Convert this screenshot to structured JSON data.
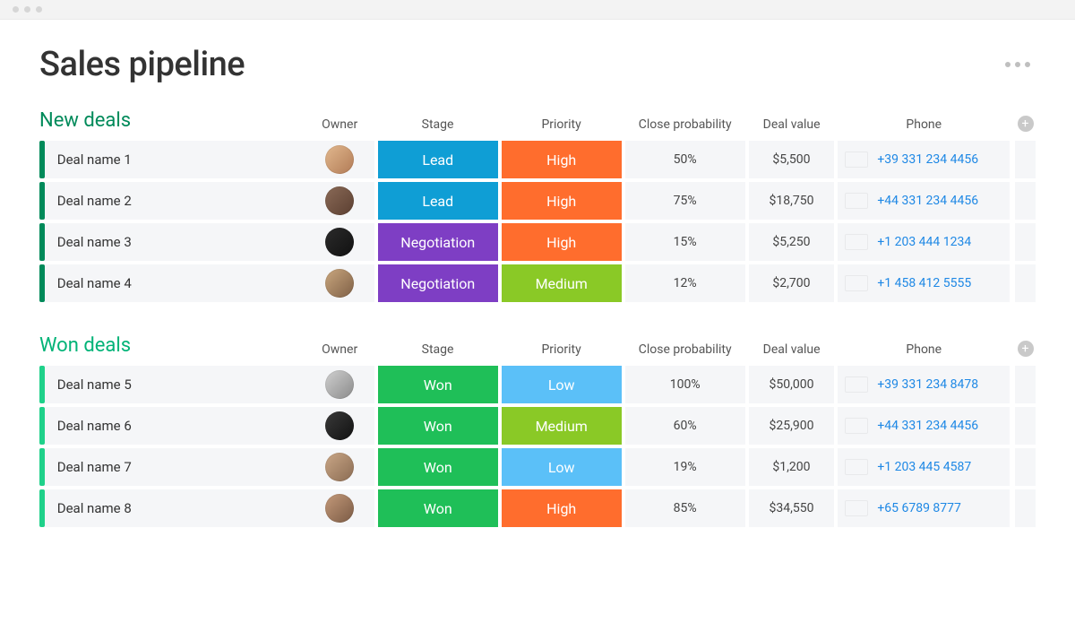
{
  "page": {
    "title": "Sales pipeline"
  },
  "columns": {
    "owner": "Owner",
    "stage": "Stage",
    "priority": "Priority",
    "close_probability": "Close probability",
    "deal_value": "Deal value",
    "phone": "Phone"
  },
  "colors": {
    "stage": {
      "Lead": "bg-blue",
      "Negotiation": "bg-purple",
      "Won": "bg-green"
    },
    "priority": {
      "High": "bg-orange",
      "Medium": "bg-lime",
      "Low": "bg-sky"
    }
  },
  "sections": [
    {
      "title": "New deals",
      "accent": "#008a5a",
      "title_class": "dark",
      "rows": [
        {
          "name": "Deal name 1",
          "avatar": "linear-gradient(135deg,#e2b98f,#b17a55)",
          "stage": "Lead",
          "priority": "High",
          "prob": "50%",
          "value": "$5,500",
          "flag": "tonga",
          "phone": "+39 331 234 4456"
        },
        {
          "name": "Deal name 2",
          "avatar": "linear-gradient(135deg,#8a6a57,#5b3f31)",
          "stage": "Lead",
          "priority": "High",
          "prob": "75%",
          "value": "$18,750",
          "flag": "uk",
          "phone": "+44 331 234 4456"
        },
        {
          "name": "Deal name 3",
          "avatar": "linear-gradient(135deg,#2b2b2b,#111111)",
          "stage": "Negotiation",
          "priority": "High",
          "prob": "15%",
          "value": "$5,250",
          "flag": "us",
          "phone": "+1 203 444 1234"
        },
        {
          "name": "Deal name 4",
          "avatar": "linear-gradient(135deg,#caa77f,#7e5f45)",
          "stage": "Negotiation",
          "priority": "Medium",
          "prob": "12%",
          "value": "$2,700",
          "flag": "us",
          "phone": "+1 458 412 5555"
        }
      ]
    },
    {
      "title": "Won deals",
      "accent": "#1fd18a",
      "title_class": "",
      "rows": [
        {
          "name": "Deal name 5",
          "avatar": "linear-gradient(135deg,#d0d0d0,#8a8a8a)",
          "stage": "Won",
          "priority": "Low",
          "prob": "100%",
          "value": "$50,000",
          "flag": "ru",
          "phone": "+39 331 234 8478"
        },
        {
          "name": "Deal name 6",
          "avatar": "linear-gradient(135deg,#3a3a3a,#111111)",
          "stage": "Won",
          "priority": "Medium",
          "prob": "60%",
          "value": "$25,900",
          "flag": "gg",
          "phone": "+44 331 234 4456"
        },
        {
          "name": "Deal name 7",
          "avatar": "linear-gradient(135deg,#caa787,#8a6b52)",
          "stage": "Won",
          "priority": "Low",
          "prob": "19%",
          "value": "$1,200",
          "flag": "us",
          "phone": "+1 203 445 4587"
        },
        {
          "name": "Deal name 8",
          "avatar": "linear-gradient(135deg,#c49a7a,#7a5a44)",
          "stage": "Won",
          "priority": "High",
          "prob": "85%",
          "value": "$34,550",
          "flag": "sg",
          "phone": "+65 6789 8777"
        }
      ]
    }
  ]
}
